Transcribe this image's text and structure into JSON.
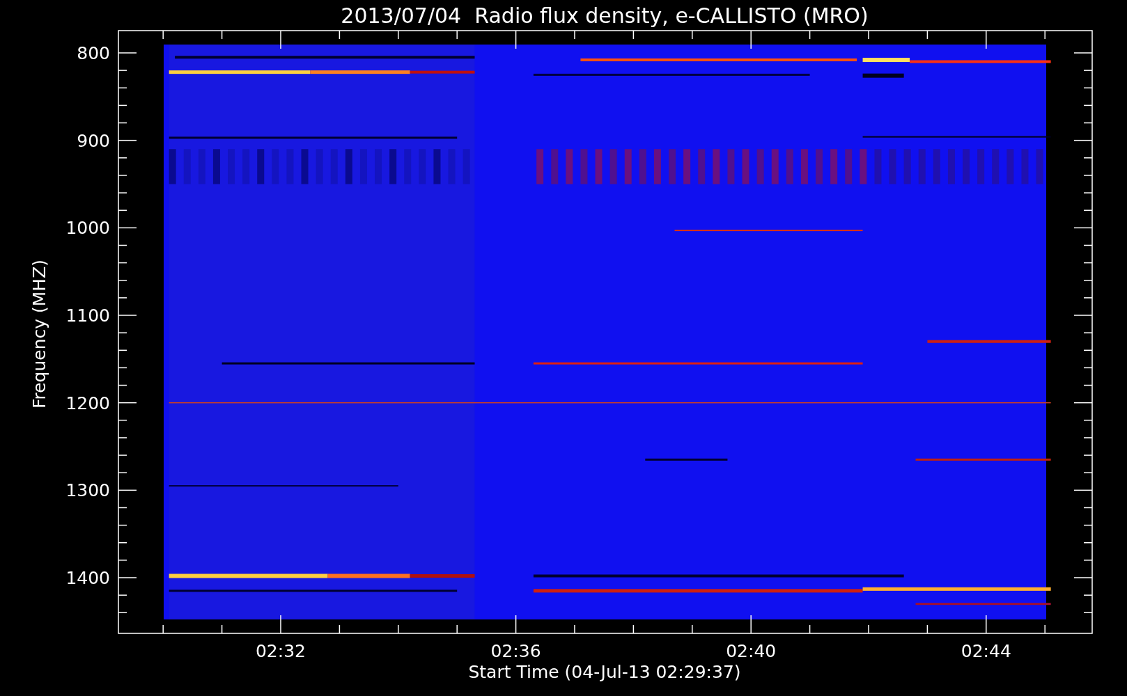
{
  "title": "2013/07/04  Radio flux density, e-CALLISTO (MRO)",
  "y_axis": {
    "label": "Frequency (MHZ)",
    "ticks": [
      "800",
      "900",
      "1000",
      "1100",
      "1200",
      "1300",
      "1400"
    ]
  },
  "x_axis": {
    "label": "Start Time (04-Jul-13 02:29:37)",
    "ticks": [
      "02:32",
      "02:36",
      "02:40",
      "02:44"
    ]
  }
}
